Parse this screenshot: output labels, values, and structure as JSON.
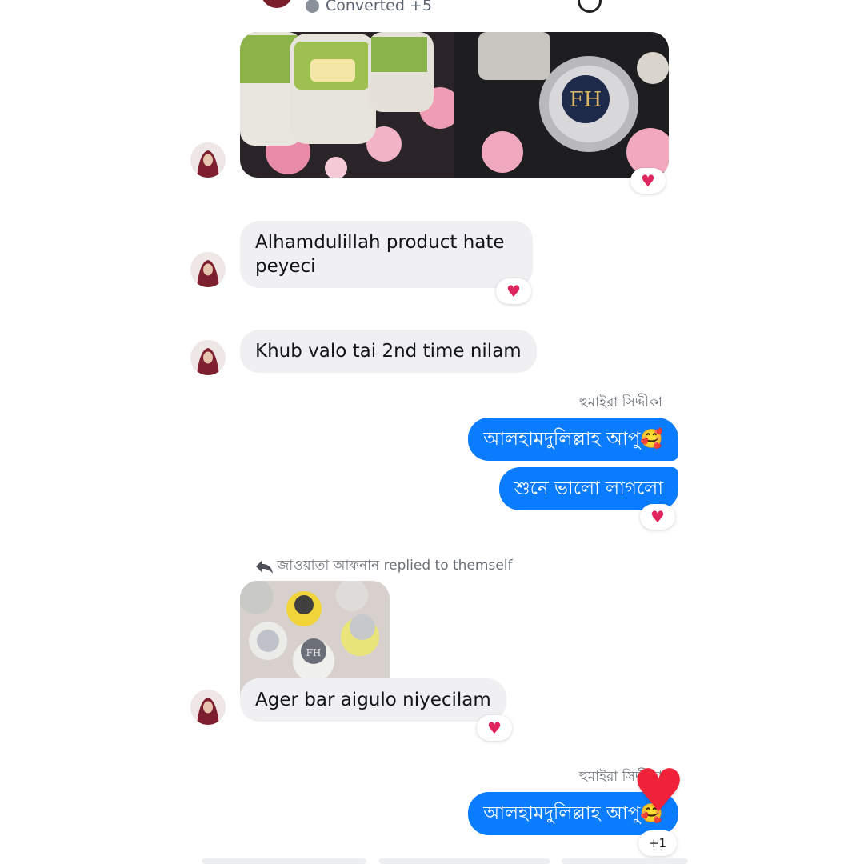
{
  "colors": {
    "outgoing_bubble": "#0a7cff",
    "incoming_bubble": "#f0f0f2",
    "reaction_heart": "#e0245e"
  },
  "header": {
    "converted_label": "Converted +5"
  },
  "icons": {
    "heart": "♥",
    "reply": "reply-arrow-icon"
  },
  "messages": [
    {
      "id": "m1",
      "direction": "incoming",
      "type": "photos",
      "photo_count": 2,
      "reaction": "♥"
    },
    {
      "id": "m2",
      "direction": "incoming",
      "text": "Alhamdulillah product hate peyeci",
      "reaction": "♥"
    },
    {
      "id": "m3",
      "direction": "incoming",
      "text": "Khub valo tai 2nd time nilam"
    },
    {
      "id": "m4",
      "direction": "outgoing",
      "sender": "হুমাইরা সিদ্দীকা",
      "text": "আলহামদুলিল্লাহ আপু🥰"
    },
    {
      "id": "m5",
      "direction": "outgoing",
      "text": "শুনে ভালো লাগলো",
      "reaction": "♥"
    },
    {
      "id": "m6",
      "direction": "incoming",
      "reply_note": "জাওয়াতা আফনান replied to themself",
      "type": "photo"
    },
    {
      "id": "m7",
      "direction": "incoming",
      "text": "Ager bar aigulo niyecilam",
      "reaction": "♥"
    },
    {
      "id": "m8",
      "direction": "outgoing",
      "sender": "হুমাইরা সিদ্দীকা",
      "text": "আলহামদুলিল্লাহ আপু🥰",
      "reaction": "♥",
      "reaction_count": "+1"
    }
  ]
}
